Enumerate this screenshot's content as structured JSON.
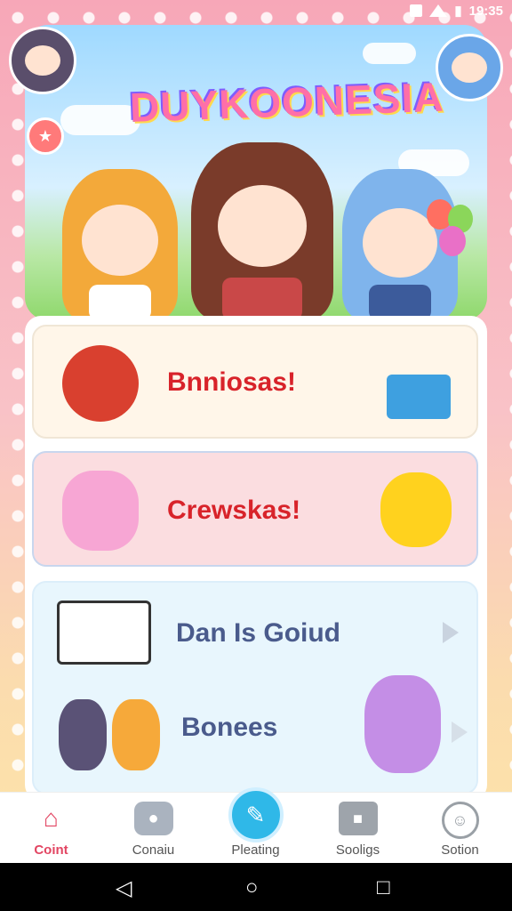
{
  "status_bar": {
    "time": "19:35"
  },
  "header": {
    "app_title": "DUYKOONESIA"
  },
  "menu": [
    {
      "label": "Bnniosas!",
      "color": "#d8232a"
    },
    {
      "label": "Crewskas!",
      "color": "#d8232a"
    },
    {
      "label": "Dan Is Goiud",
      "color": "#4a5b8c"
    },
    {
      "label": "Bonees",
      "color": "#4a5b8c"
    }
  ],
  "bottom_nav": [
    {
      "label": "Coint",
      "icon": "home-icon",
      "active": true
    },
    {
      "label": "Conaiu",
      "icon": "game-controller-icon"
    },
    {
      "label": "Pleating",
      "icon": "pen-icon"
    },
    {
      "label": "Sooligs",
      "icon": "gift-box-icon"
    },
    {
      "label": "Sotion",
      "icon": "profile-icon"
    }
  ]
}
